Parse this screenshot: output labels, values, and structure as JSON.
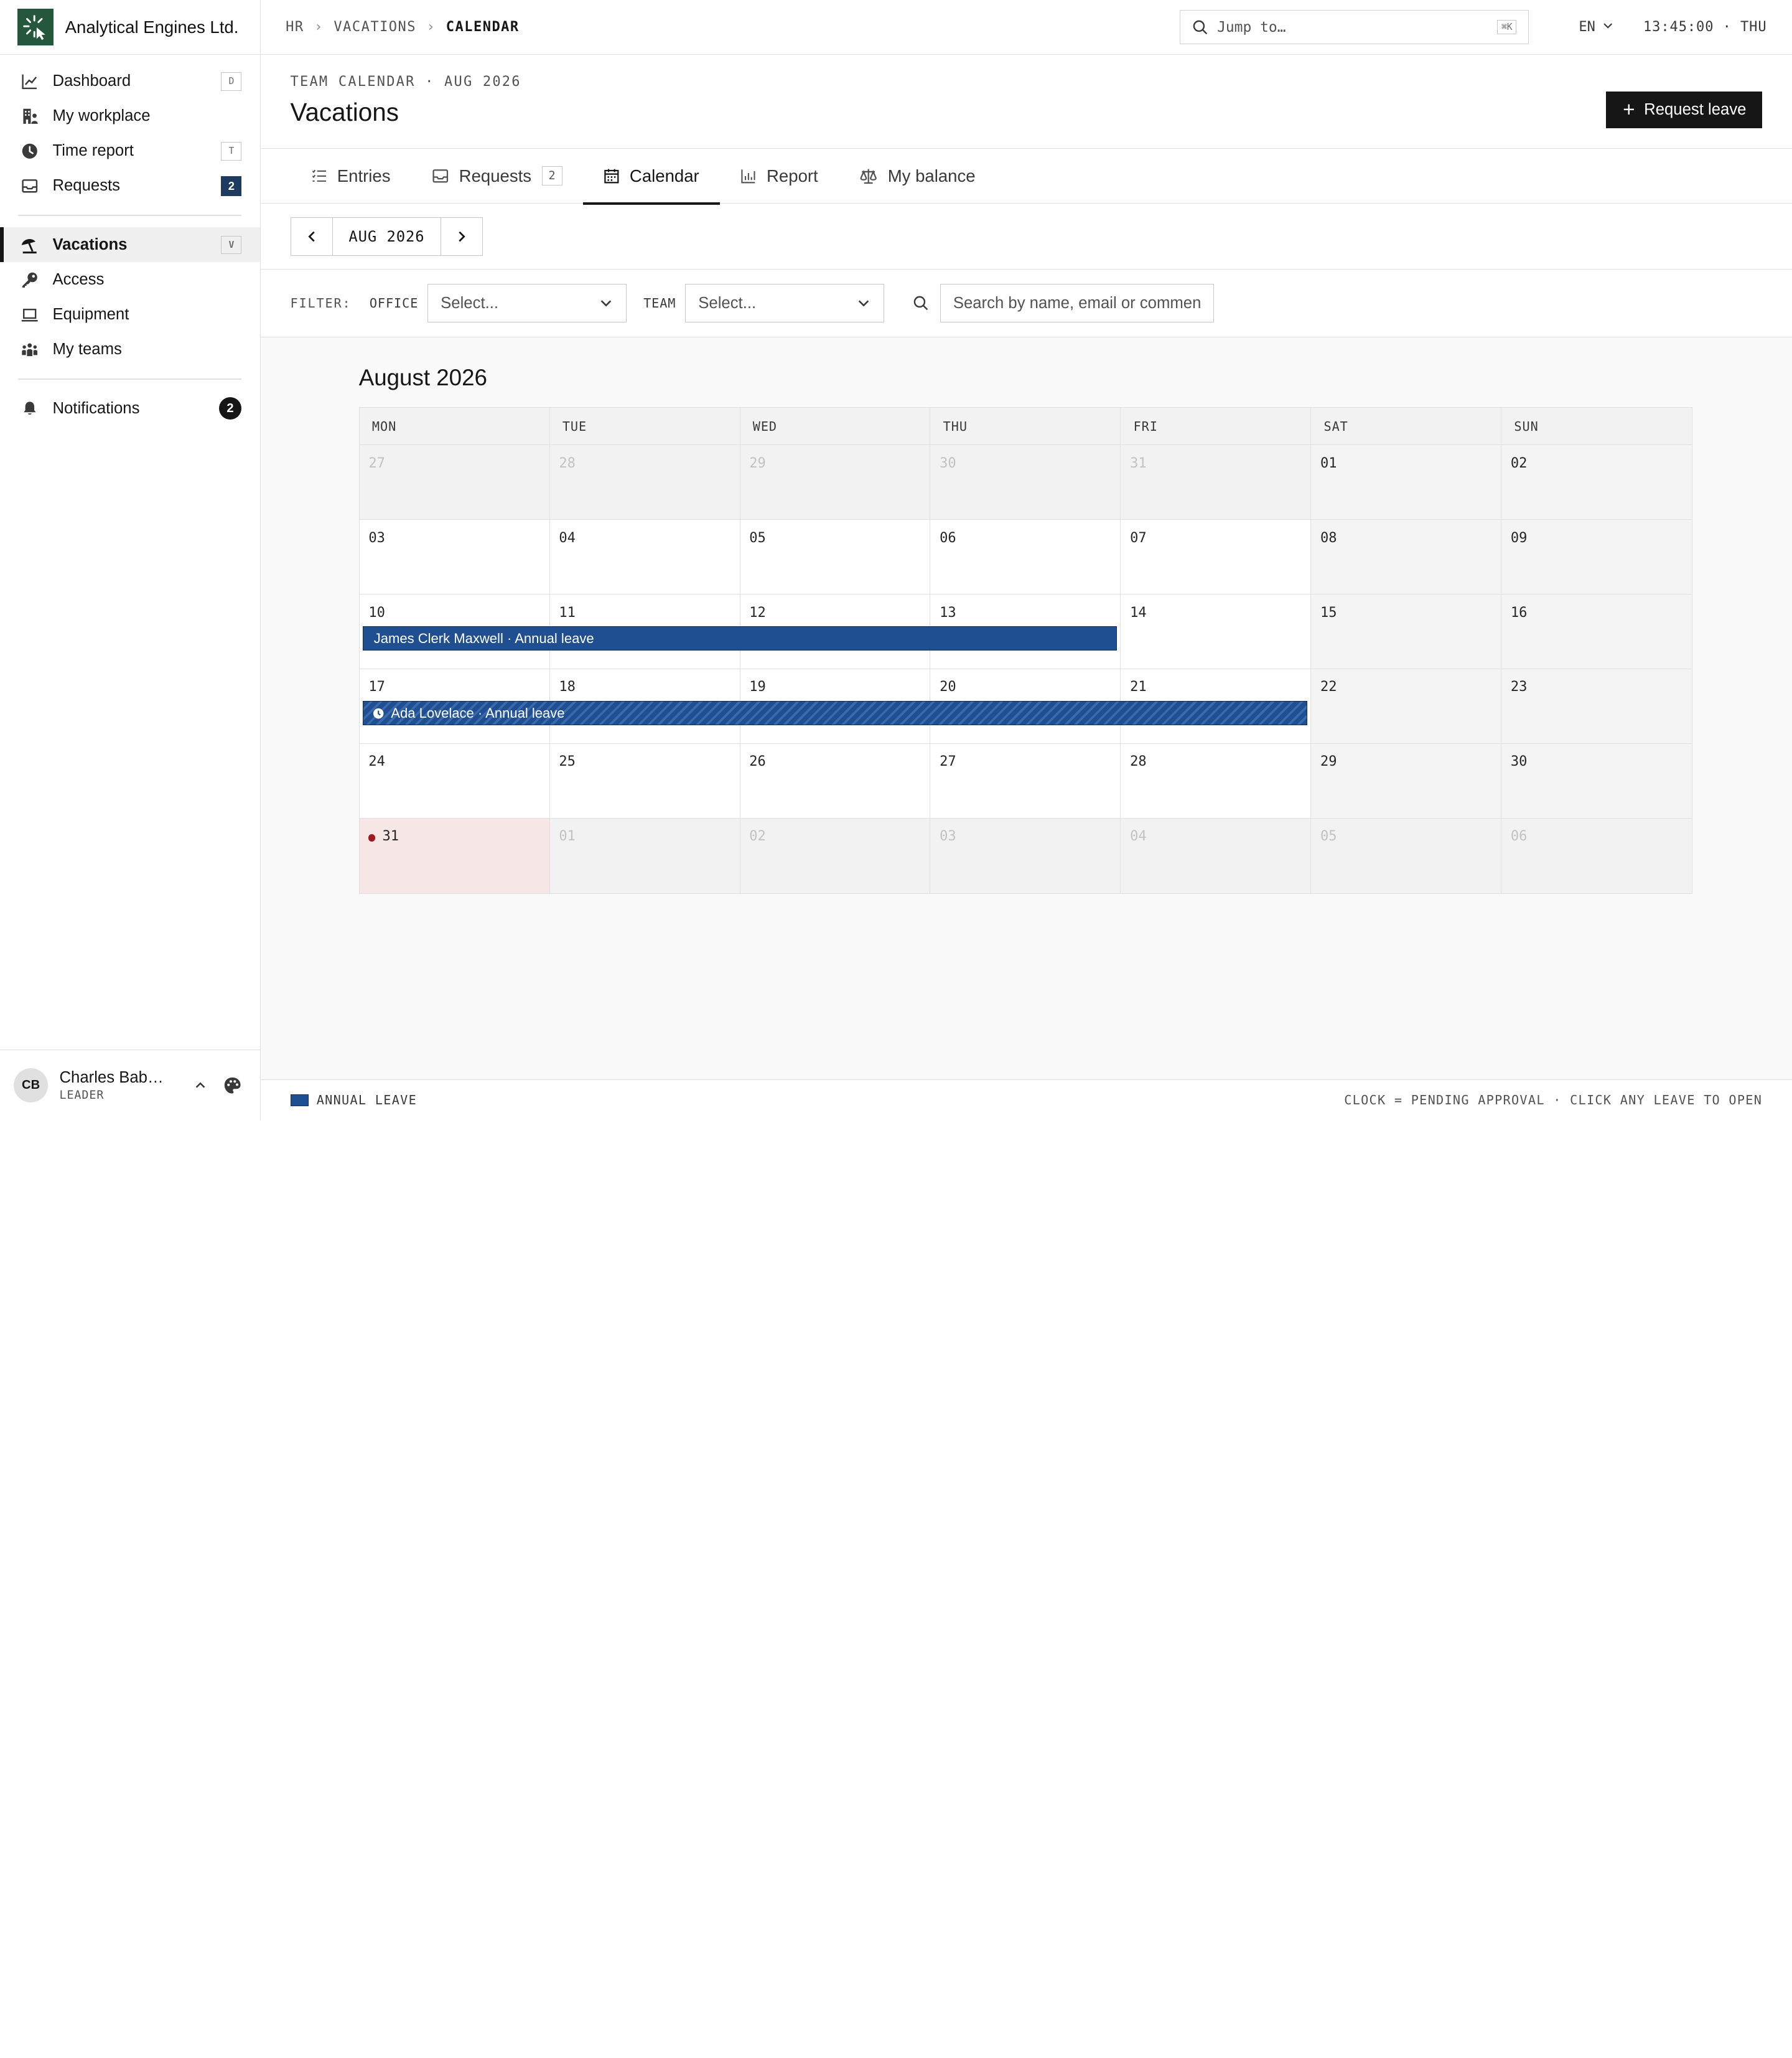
{
  "brand": {
    "name": "Analytical Engines Ltd.",
    "logo_color": "#24573b"
  },
  "sidebar": {
    "group1": [
      {
        "label": "Dashboard",
        "icon": "chart-line-icon",
        "shortcut": "D"
      },
      {
        "label": "My workplace",
        "icon": "building-icon"
      },
      {
        "label": "Time report",
        "icon": "clock-icon",
        "shortcut": "T"
      },
      {
        "label": "Requests",
        "icon": "inbox-icon",
        "badge": "2"
      }
    ],
    "group2": [
      {
        "label": "Vacations",
        "icon": "beach-umbrella-icon",
        "shortcut": "V",
        "active": true
      },
      {
        "label": "Access",
        "icon": "key-icon"
      },
      {
        "label": "Equipment",
        "icon": "laptop-icon"
      },
      {
        "label": "My teams",
        "icon": "people-icon"
      }
    ],
    "group3": [
      {
        "label": "Notifications",
        "icon": "bell-icon",
        "badge": "2"
      }
    ]
  },
  "user": {
    "initials": "CB",
    "name": "Charles Babbage",
    "role": "LEADER"
  },
  "topbar": {
    "breadcrumb": [
      "HR",
      "VACATIONS",
      "CALENDAR"
    ],
    "search_placeholder": "Jump to…",
    "search_shortcut": "⌘K",
    "language": "EN",
    "time": "13:45:00 · THU"
  },
  "page": {
    "eyebrow": "TEAM CALENDAR · AUG 2026",
    "title": "Vacations",
    "request_button": "Request leave"
  },
  "tabs": [
    {
      "label": "Entries",
      "icon": "list-icon"
    },
    {
      "label": "Requests",
      "icon": "inbox-icon",
      "count": "2"
    },
    {
      "label": "Calendar",
      "icon": "calendar-icon",
      "active": true
    },
    {
      "label": "Report",
      "icon": "bar-chart-icon"
    },
    {
      "label": "My balance",
      "icon": "scale-icon"
    }
  ],
  "month_nav": {
    "label": "AUG 2026"
  },
  "filters": {
    "label": "FILTER:",
    "office_label": "OFFICE",
    "office_value": "Select...",
    "team_label": "TEAM",
    "team_value": "Select...",
    "search_placeholder": "Search by name, email or comment"
  },
  "calendar": {
    "title": "August 2026",
    "weekdays": [
      "MON",
      "TUE",
      "WED",
      "THU",
      "FRI",
      "SAT",
      "SUN"
    ],
    "weeks": [
      [
        "27",
        "28",
        "29",
        "30",
        "31",
        "01",
        "02"
      ],
      [
        "03",
        "04",
        "05",
        "06",
        "07",
        "08",
        "09"
      ],
      [
        "10",
        "11",
        "12",
        "13",
        "14",
        "15",
        "16"
      ],
      [
        "17",
        "18",
        "19",
        "20",
        "21",
        "22",
        "23"
      ],
      [
        "24",
        "25",
        "26",
        "27",
        "28",
        "29",
        "30"
      ],
      [
        "31",
        "01",
        "02",
        "03",
        "04",
        "05",
        "06"
      ]
    ],
    "today": "31",
    "events": [
      {
        "label": "James Clerk Maxwell · Annual leave",
        "start": "2026-08-10",
        "end": "2026-08-13",
        "pending": false
      },
      {
        "label": "Ada Lovelace · Annual leave",
        "start": "2026-08-17",
        "end": "2026-08-21",
        "pending": true
      }
    ],
    "event_color": "#1f4e91"
  },
  "legend": {
    "item": "ANNUAL LEAVE",
    "hint": "CLOCK = PENDING APPROVAL · CLICK ANY LEAVE TO OPEN"
  }
}
